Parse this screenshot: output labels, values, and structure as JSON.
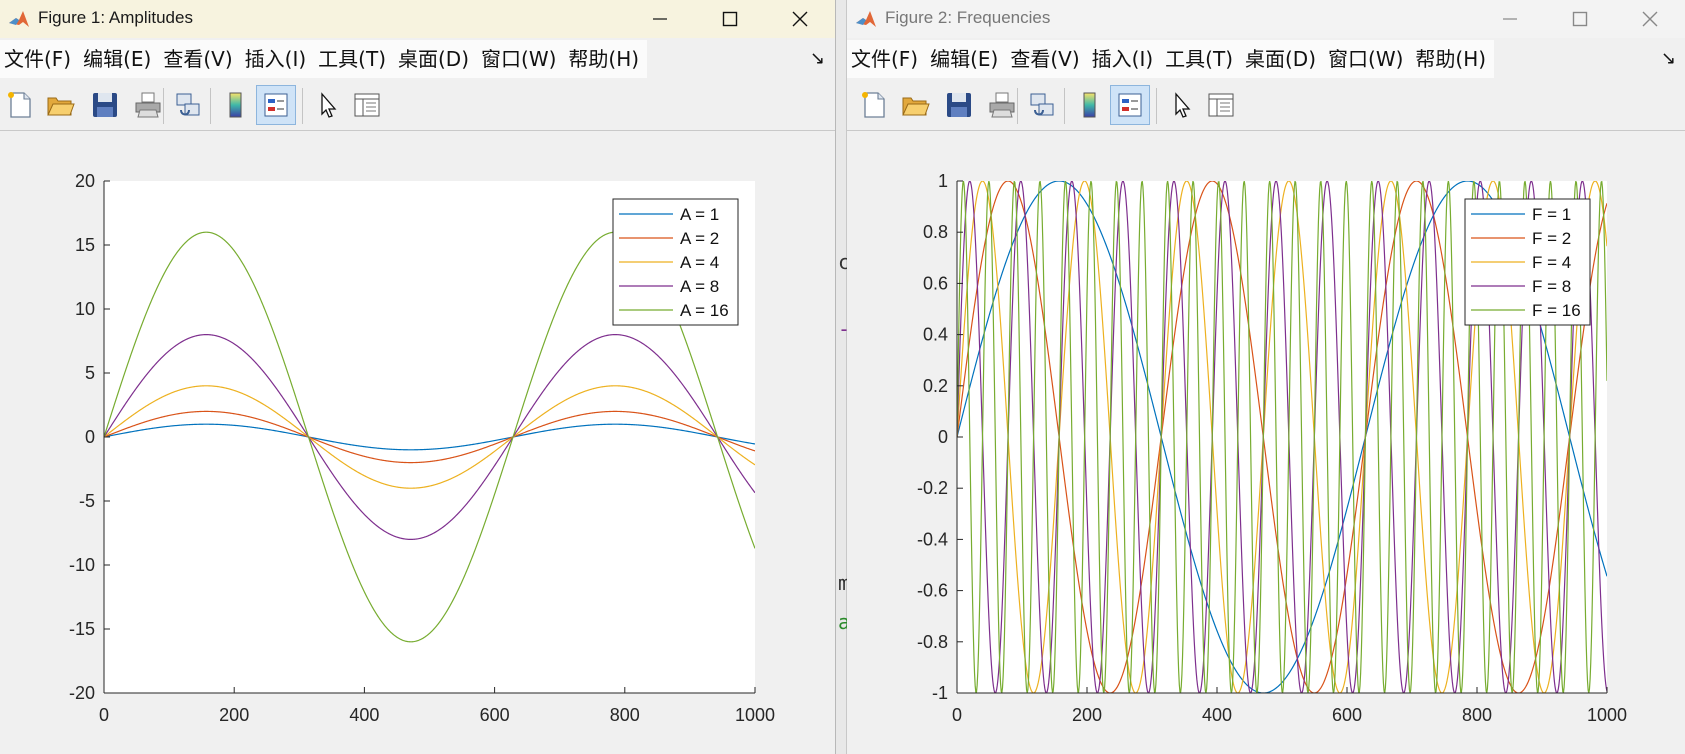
{
  "windows": [
    {
      "title": "Figure 1: Amplitudes",
      "menu": [
        "文件(F)",
        "编辑(E)",
        "查看(V)",
        "插入(I)",
        "工具(T)",
        "桌面(D)",
        "窗口(W)",
        "帮助(H)"
      ]
    },
    {
      "title": "Figure 2: Frequencies",
      "menu": [
        "文件(F)",
        "编辑(E)",
        "查看(V)",
        "插入(I)",
        "工具(T)",
        "桌面(D)",
        "窗口(W)",
        "帮助(H)"
      ]
    }
  ],
  "toolbar_icons": [
    "new-figure-icon",
    "open-file-icon",
    "save-icon",
    "print-icon",
    "link-icon",
    "colorbar-icon",
    "legend-icon",
    "pointer-icon",
    "property-inspector-icon"
  ],
  "background_fragments": [
    "c",
    "-",
    "m",
    "a"
  ],
  "colors": {
    "series": [
      "#0072BD",
      "#D95319",
      "#EDB120",
      "#7E2F8E",
      "#77AC30"
    ],
    "titlebar_active": "#f7f3df",
    "toolbar_active": "#cfe3f7"
  },
  "chart_data": [
    {
      "type": "line",
      "function": "y = A*sin(x/100)",
      "x": {
        "start": 0,
        "end": 1000,
        "step": 1
      },
      "series": [
        {
          "name": "A = 1",
          "amplitude": 1,
          "frequency": 1
        },
        {
          "name": "A = 2",
          "amplitude": 2,
          "frequency": 1
        },
        {
          "name": "A = 4",
          "amplitude": 4,
          "frequency": 1
        },
        {
          "name": "A = 8",
          "amplitude": 8,
          "frequency": 1
        },
        {
          "name": "A = 16",
          "amplitude": 16,
          "frequency": 1
        }
      ],
      "xlim": [
        0,
        1000
      ],
      "ylim": [
        -20,
        20
      ],
      "xticks": [
        0,
        200,
        400,
        600,
        800,
        1000
      ],
      "yticks": [
        20,
        15,
        10,
        5,
        0,
        -5,
        -10,
        -15,
        -20
      ],
      "legend": "top-right",
      "grid": false
    },
    {
      "type": "line",
      "function": "y = sin(F*x/100)",
      "x": {
        "start": 0,
        "end": 1000,
        "step": 1
      },
      "series": [
        {
          "name": "F = 1",
          "amplitude": 1,
          "frequency": 1
        },
        {
          "name": "F = 2",
          "amplitude": 1,
          "frequency": 2
        },
        {
          "name": "F = 4",
          "amplitude": 1,
          "frequency": 4
        },
        {
          "name": "F = 8",
          "amplitude": 1,
          "frequency": 8
        },
        {
          "name": "F = 16",
          "amplitude": 1,
          "frequency": 16
        }
      ],
      "xlim": [
        0,
        1000
      ],
      "ylim": [
        -1,
        1
      ],
      "xticks": [
        0,
        200,
        400,
        600,
        800,
        1000
      ],
      "yticks": [
        1,
        0.8,
        0.6,
        0.4,
        0.2,
        0,
        -0.2,
        -0.4,
        -0.6,
        -0.8,
        -1
      ],
      "legend": "top-right",
      "grid": false
    }
  ]
}
